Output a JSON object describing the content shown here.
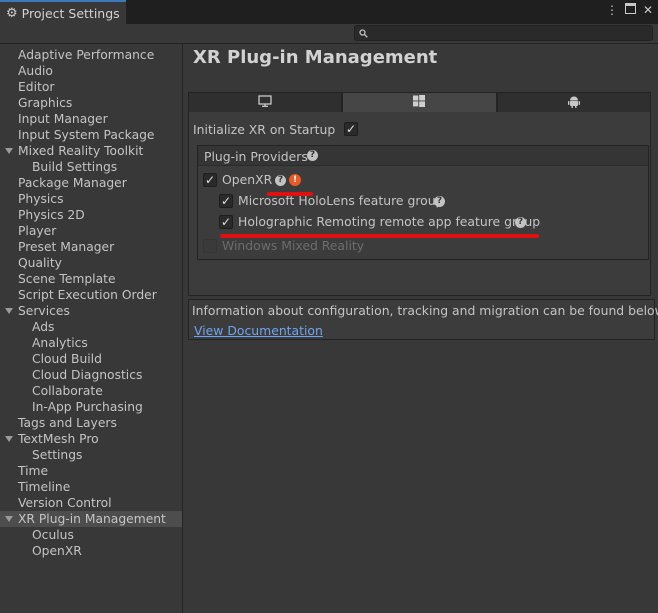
{
  "window": {
    "tab_title": "Project Settings",
    "tab_icon": "gear-icon",
    "controls": [
      "menu-icon",
      "maximize-icon",
      "close-icon"
    ]
  },
  "search": {
    "placeholder": "",
    "value": ""
  },
  "sidebar": {
    "items": [
      {
        "label": "Adaptive Performance",
        "level": 0
      },
      {
        "label": "Audio",
        "level": 0
      },
      {
        "label": "Editor",
        "level": 0
      },
      {
        "label": "Graphics",
        "level": 0
      },
      {
        "label": "Input Manager",
        "level": 0
      },
      {
        "label": "Input System Package",
        "level": 0
      },
      {
        "label": "Mixed Reality Toolkit",
        "level": 0,
        "expanded": true
      },
      {
        "label": "Build Settings",
        "level": 1
      },
      {
        "label": "Package Manager",
        "level": 0
      },
      {
        "label": "Physics",
        "level": 0
      },
      {
        "label": "Physics 2D",
        "level": 0
      },
      {
        "label": "Player",
        "level": 0
      },
      {
        "label": "Preset Manager",
        "level": 0
      },
      {
        "label": "Quality",
        "level": 0
      },
      {
        "label": "Scene Template",
        "level": 0
      },
      {
        "label": "Script Execution Order",
        "level": 0
      },
      {
        "label": "Services",
        "level": 0,
        "expanded": true
      },
      {
        "label": "Ads",
        "level": 1
      },
      {
        "label": "Analytics",
        "level": 1
      },
      {
        "label": "Cloud Build",
        "level": 1
      },
      {
        "label": "Cloud Diagnostics",
        "level": 1
      },
      {
        "label": "Collaborate",
        "level": 1
      },
      {
        "label": "In-App Purchasing",
        "level": 1
      },
      {
        "label": "Tags and Layers",
        "level": 0
      },
      {
        "label": "TextMesh Pro",
        "level": 0,
        "expanded": true
      },
      {
        "label": "Settings",
        "level": 1
      },
      {
        "label": "Time",
        "level": 0
      },
      {
        "label": "Timeline",
        "level": 0
      },
      {
        "label": "Version Control",
        "level": 0
      },
      {
        "label": "XR Plug-in Management",
        "level": 0,
        "expanded": true,
        "selected": true
      },
      {
        "label": "Oculus",
        "level": 1
      },
      {
        "label": "OpenXR",
        "level": 1
      }
    ]
  },
  "main": {
    "title": "XR Plug-in Management",
    "platform_tabs": [
      {
        "icon": "monitor-icon",
        "active": false
      },
      {
        "icon": "windows-icon",
        "active": true
      },
      {
        "icon": "android-icon",
        "active": false
      }
    ],
    "initialize_xr": {
      "label": "Initialize XR on Startup",
      "checked": true
    },
    "providers": {
      "header": "Plug-in Providers",
      "openxr": {
        "label": "OpenXR",
        "checked": true
      },
      "hololens": {
        "label": "Microsoft HoloLens feature group",
        "checked": true
      },
      "holographic": {
        "label": "Holographic Remoting remote app feature group",
        "checked": true
      },
      "wmr": {
        "label": "Windows Mixed Reality",
        "checked": false,
        "disabled": true
      }
    },
    "info": {
      "text": "Information about configuration, tracking and migration can be found below.",
      "link": "View Documentation"
    }
  },
  "colors": {
    "background": "#383838",
    "accent_tab": "#3a79bb",
    "warning": "#ea5a24",
    "annotation": "#e01010",
    "link": "#6fa3ef"
  }
}
